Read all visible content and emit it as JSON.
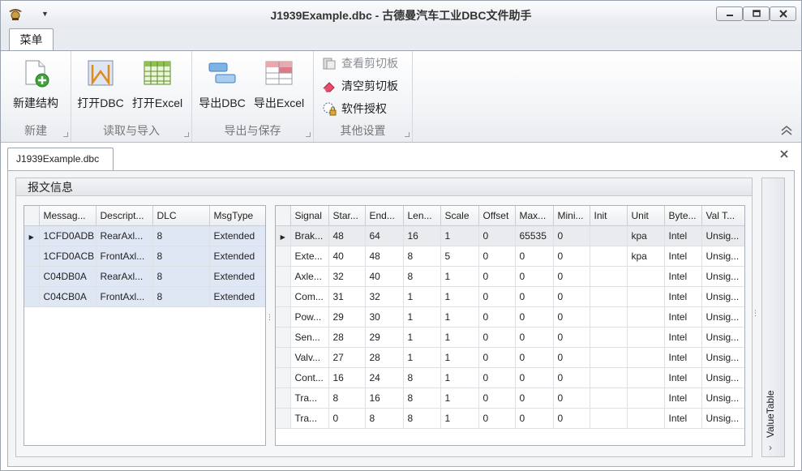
{
  "window": {
    "title_bold": "J1939Example.dbc",
    "title_rest": " - 古德曼汽车工业DBC文件助手",
    "minimize_icon": "minimize-icon",
    "maximize_icon": "maximize-icon",
    "close_icon": "close-icon"
  },
  "ribbon": {
    "menu_tab": "菜单",
    "groups": {
      "new": {
        "label": "新建",
        "buttons": {
          "new_structure": "新建结构"
        }
      },
      "read_import": {
        "label": "读取与导入",
        "buttons": {
          "open_dbc": "打开DBC",
          "open_excel": "打开Excel"
        }
      },
      "export_save": {
        "label": "导出与保存",
        "buttons": {
          "export_dbc": "导出DBC",
          "export_excel": "导出Excel"
        }
      },
      "other": {
        "label": "其他设置",
        "buttons": {
          "view_clipboard": "查看剪切板",
          "clear_clipboard": "清空剪切板",
          "license": "软件授权"
        }
      }
    }
  },
  "document": {
    "tab": "J1939Example.dbc",
    "panel_title": "报文信息",
    "side_panel": "ValueTable"
  },
  "messages": {
    "columns": [
      "Messag...",
      "Descript...",
      "DLC",
      "MsgType"
    ],
    "rows": [
      [
        "1CFD0ADB",
        "RearAxl...",
        "8",
        "Extended"
      ],
      [
        "1CFD0ACB",
        "FrontAxl...",
        "8",
        "Extended"
      ],
      [
        "C04DB0A",
        "RearAxl...",
        "8",
        "Extended"
      ],
      [
        "C04CB0A",
        "FrontAxl...",
        "8",
        "Extended"
      ]
    ]
  },
  "signals": {
    "columns": [
      "Signal",
      "Star...",
      "End...",
      "Len...",
      "Scale",
      "Offset",
      "Max...",
      "Mini...",
      "Init",
      "Unit",
      "Byte...",
      "Val T..."
    ],
    "rows": [
      [
        "Brak...",
        "48",
        "64",
        "16",
        "1",
        "0",
        "65535",
        "0",
        "",
        "kpa",
        "Intel",
        "Unsig..."
      ],
      [
        "Exte...",
        "40",
        "48",
        "8",
        "5",
        "0",
        "0",
        "0",
        "",
        "kpa",
        "Intel",
        "Unsig..."
      ],
      [
        "Axle...",
        "32",
        "40",
        "8",
        "1",
        "0",
        "0",
        "0",
        "",
        "",
        "Intel",
        "Unsig..."
      ],
      [
        "Com...",
        "31",
        "32",
        "1",
        "1",
        "0",
        "0",
        "0",
        "",
        "",
        "Intel",
        "Unsig..."
      ],
      [
        "Pow...",
        "29",
        "30",
        "1",
        "1",
        "0",
        "0",
        "0",
        "",
        "",
        "Intel",
        "Unsig..."
      ],
      [
        "Sen...",
        "28",
        "29",
        "1",
        "1",
        "0",
        "0",
        "0",
        "",
        "",
        "Intel",
        "Unsig..."
      ],
      [
        "Valv...",
        "27",
        "28",
        "1",
        "1",
        "0",
        "0",
        "0",
        "",
        "",
        "Intel",
        "Unsig..."
      ],
      [
        "Cont...",
        "16",
        "24",
        "8",
        "1",
        "0",
        "0",
        "0",
        "",
        "",
        "Intel",
        "Unsig..."
      ],
      [
        "Tra...",
        "8",
        "16",
        "8",
        "1",
        "0",
        "0",
        "0",
        "",
        "",
        "Intel",
        "Unsig..."
      ],
      [
        "Tra...",
        "0",
        "8",
        "8",
        "1",
        "0",
        "0",
        "0",
        "",
        "",
        "Intel",
        "Unsig..."
      ]
    ]
  }
}
